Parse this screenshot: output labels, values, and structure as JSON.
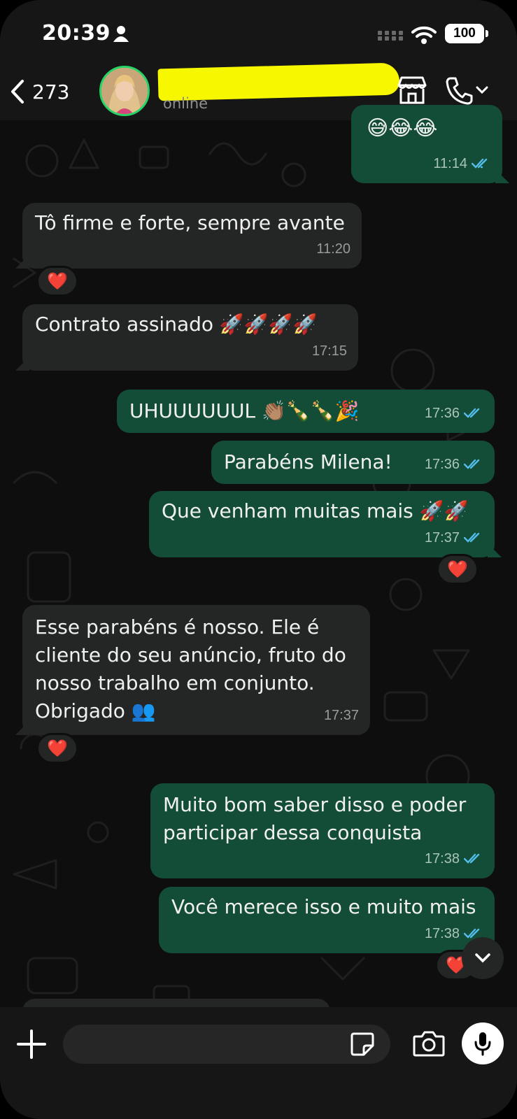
{
  "status_bar": {
    "time": "20:39",
    "battery": "100"
  },
  "header": {
    "back_count": "273",
    "contact_name": "",
    "contact_status": "online"
  },
  "colors": {
    "incoming_bubble": "#242626",
    "outgoing_bubble": "#134d37",
    "read_ticks": "#53bdeb",
    "highlighter": "#f7f700",
    "online_ring": "#25d366"
  },
  "icons": {
    "back": "chevron-left-icon",
    "store": "store-icon",
    "call": "phone-icon",
    "call_menu": "chevron-down-icon",
    "attach": "plus-icon",
    "sticker": "sticker-icon",
    "camera": "camera-icon",
    "mic": "microphone-icon",
    "scroll_down": "chevron-down-icon"
  },
  "messages": [
    {
      "direction": "out",
      "text": "😅😂😂",
      "time": "11:14",
      "read": true
    },
    {
      "direction": "in",
      "text": "Tô firme e forte, sempre avante",
      "time": "11:20",
      "reaction": "❤️"
    },
    {
      "direction": "in",
      "text": "Contrato assinado 🚀🚀🚀🚀",
      "time": "17:15"
    },
    {
      "direction": "out",
      "text": "UHUUUUUUL 👏🏽🍾🍾🎉",
      "time": "17:36",
      "read": true
    },
    {
      "direction": "out",
      "text": "Parabéns Milena!",
      "time": "17:36",
      "read": true
    },
    {
      "direction": "out",
      "text": "Que venham muitas mais 🚀🚀",
      "time": "17:37",
      "read": true,
      "reaction": "❤️"
    },
    {
      "direction": "in",
      "text": "Esse parabéns é nosso. Ele é\ncliente do seu anúncio, fruto do\nnosso trabalho em conjunto.\nObrigado 👥",
      "time": "17:37",
      "reaction": "❤️"
    },
    {
      "direction": "out",
      "text": "Muito bom saber disso e poder\nparticipar dessa conquista",
      "time": "17:38",
      "read": true
    },
    {
      "direction": "out",
      "text": "Você merece isso e muito mais",
      "time": "17:38",
      "read": true,
      "reaction": "❤️"
    }
  ],
  "composer": {
    "placeholder": ""
  }
}
